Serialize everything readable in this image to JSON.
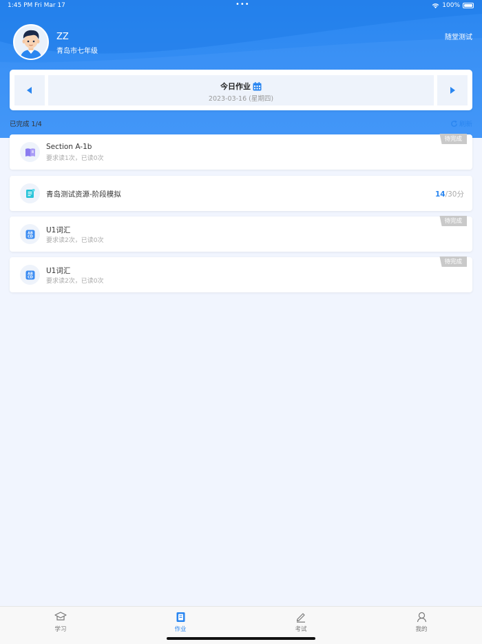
{
  "status_bar": {
    "time": "1:45 PM",
    "date": "Fri Mar 17",
    "battery": "100%"
  },
  "profile": {
    "name": "ZZ",
    "class_info": "青岛市七年级",
    "quiz_link": "随堂测试"
  },
  "date_nav": {
    "title": "今日作业",
    "date": "2023-03-16 (星期四)"
  },
  "progress": {
    "label": "已完成 1/4",
    "refresh_label": "刷新"
  },
  "tasks": [
    {
      "icon": "book-icon",
      "title": "Section A-1b",
      "subtitle": "要求读1次，已读0次",
      "badge": "待完成"
    },
    {
      "icon": "exam-paper-icon",
      "title": "青岛测试资源-阶段模拟",
      "score": "14",
      "score_total": "/30分"
    },
    {
      "icon": "abcd-vocab-icon",
      "title": "U1词汇",
      "subtitle": "要求读2次，已读0次",
      "badge": "待完成"
    },
    {
      "icon": "abcd-vocab-icon",
      "title": "U1词汇",
      "subtitle": "要求读2次，已读0次",
      "badge": "待完成"
    }
  ],
  "tab_bar": {
    "tabs": [
      {
        "label": "学习",
        "icon": "graduation-cap-icon",
        "active": false
      },
      {
        "label": "作业",
        "icon": "notebook-icon",
        "active": true
      },
      {
        "label": "考试",
        "icon": "pencil-icon",
        "active": false
      },
      {
        "label": "我的",
        "icon": "user-icon",
        "active": false
      }
    ]
  },
  "colors": {
    "primary": "#2a86f0",
    "background": "#f1f5fe",
    "badge": "#c9c9c9"
  }
}
